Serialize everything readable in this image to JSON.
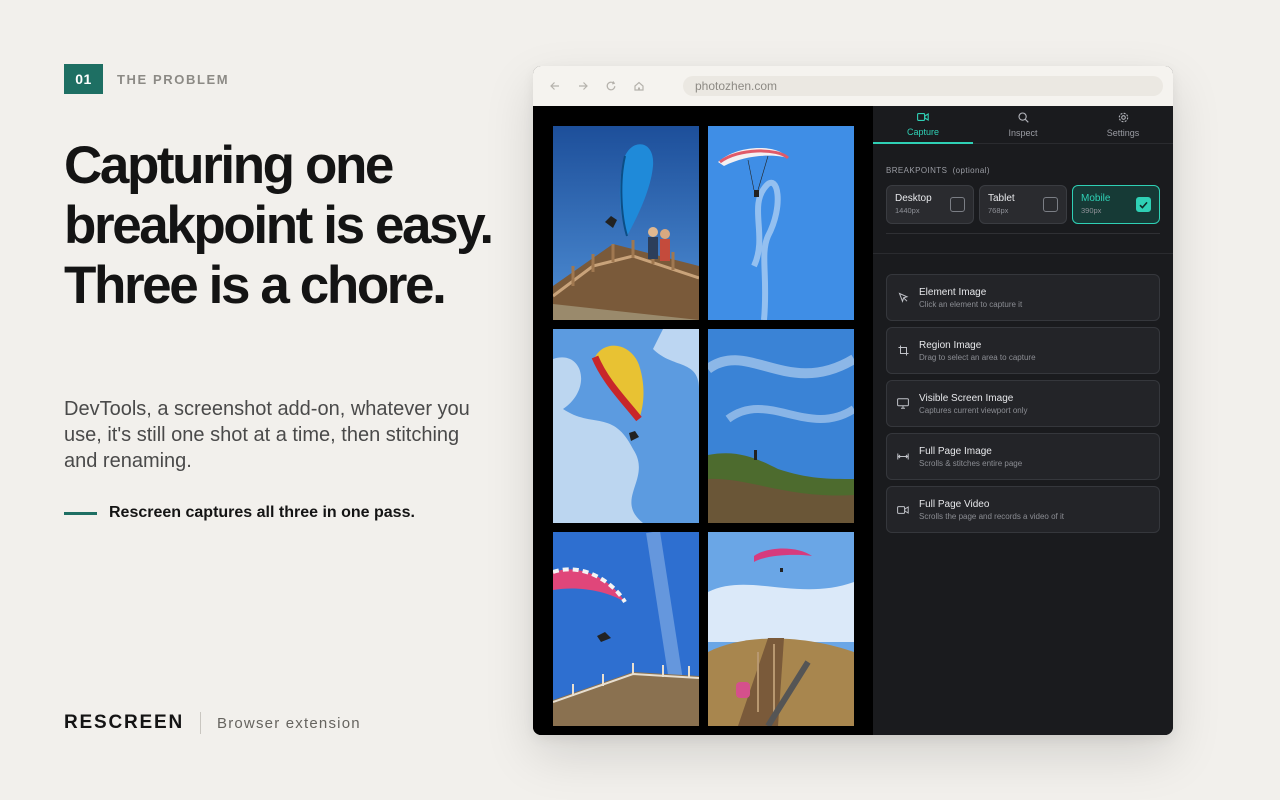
{
  "slide": {
    "step_number": "01",
    "step_label": "THE PROBLEM",
    "headline": "Capturing one breakpoint is easy. Three is a chore.",
    "body": "DevTools, a screenshot add-on, whatever you use, it's still one shot at a time, then stitching and renaming.",
    "callout": "Rescreen captures all three in one pass.",
    "brand": "RESCREEN",
    "brand_tagline": "Browser extension"
  },
  "browser": {
    "url": "photozhen.com"
  },
  "panel": {
    "tabs": [
      {
        "label": "Capture",
        "icon": "video-icon",
        "active": true
      },
      {
        "label": "Inspect",
        "icon": "search-icon",
        "active": false
      },
      {
        "label": "Settings",
        "icon": "gear-icon",
        "active": false
      }
    ],
    "breakpoints_title": "BREAKPOINTS",
    "breakpoints_optional": "(optional)",
    "breakpoints": [
      {
        "name": "Desktop",
        "size": "1440px",
        "checked": false
      },
      {
        "name": "Tablet",
        "size": "768px",
        "checked": false
      },
      {
        "name": "Mobile",
        "size": "390px",
        "checked": true
      }
    ],
    "actions": [
      {
        "title": "Element Image",
        "desc": "Click an element to capture it",
        "icon": "cursor-icon"
      },
      {
        "title": "Region Image",
        "desc": "Drag to select an area to capture",
        "icon": "crop-icon"
      },
      {
        "title": "Visible Screen Image",
        "desc": "Captures current viewport only",
        "icon": "monitor-icon"
      },
      {
        "title": "Full Page Image",
        "desc": "Scrolls & stitches entire page",
        "icon": "stretch-icon"
      },
      {
        "title": "Full Page Video",
        "desc": "Scrolls the page and records a video of it",
        "icon": "video-icon"
      }
    ]
  },
  "colors": {
    "accent": "#1e6f63",
    "panel_accent": "#2fd0b5",
    "background": "#f2f0ec"
  }
}
